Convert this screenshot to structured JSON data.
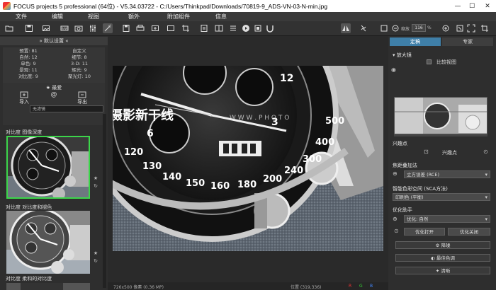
{
  "window": {
    "title": "FOCUS projects 5 professional (64位) - V5.34.03722 - C:/Users/Thinkpad/Downloads/70819-9_ADS-VN-03-N-min.jpg",
    "minimize": "—",
    "maximize": "☐",
    "close": "✕"
  },
  "menu": {
    "items": [
      "文件",
      "编辑",
      "视图",
      "额外",
      "附加组件",
      "信息"
    ]
  },
  "toolbar": {
    "zoom_label": "缩放",
    "zoom_value": "116",
    "zoom_unit": "%"
  },
  "left_panel": {
    "header": "»  默认设置  «",
    "preset_stats": [
      [
        "预置: 81",
        "自定义"
      ],
      [
        "自然: 12",
        "细节: 8"
      ],
      [
        "单色: 9",
        "3-D: 11"
      ],
      [
        "景观: 11",
        "辉光: 9"
      ],
      [
        "对比度: 9",
        "聚光灯: 10"
      ]
    ],
    "favorites_label": "最爱",
    "import_label": "导入",
    "export_label": "导出",
    "filter_value": "无滤镜",
    "presets": [
      {
        "label": "对比度 图像深度"
      },
      {
        "label": "对比度 对比度和褪色"
      },
      {
        "label": "对比度 柔和的对比度"
      }
    ]
  },
  "canvas": {
    "watermark": "摄影新干线",
    "watermark_url": "W W W . P H O T O"
  },
  "statusbar": {
    "dimensions": "726x500 像素 (0.36 MP)",
    "position": "位置 (319,336)",
    "rgb_r": "R",
    "rgb_g": "G",
    "rgb_b": "B"
  },
  "right_panel": {
    "tabs": [
      "定稿",
      "专家"
    ],
    "magnifier": "放大镜",
    "compare_view": "比较视图",
    "roi_title": "兴趣点",
    "roi_label": "兴趣点",
    "blend_title": "焦距叠加法",
    "blend_value": "立方误差 (RCE)",
    "colorspace_title": "智能色彩空间 (SCA方法)",
    "colorspace_value": "印刷色 (平衡)",
    "optimize_title": "优化助手",
    "optimize_value": "优化: 自然",
    "optimize_on": "优化打开",
    "optimize_off": "优化关闭",
    "action_sharpen": "降噪",
    "action_bestcolor": "最佳色调",
    "action_clear": "清晰"
  },
  "colors": {
    "selected_border": "#3cd64a",
    "active_tab": "#3f7fa8"
  }
}
